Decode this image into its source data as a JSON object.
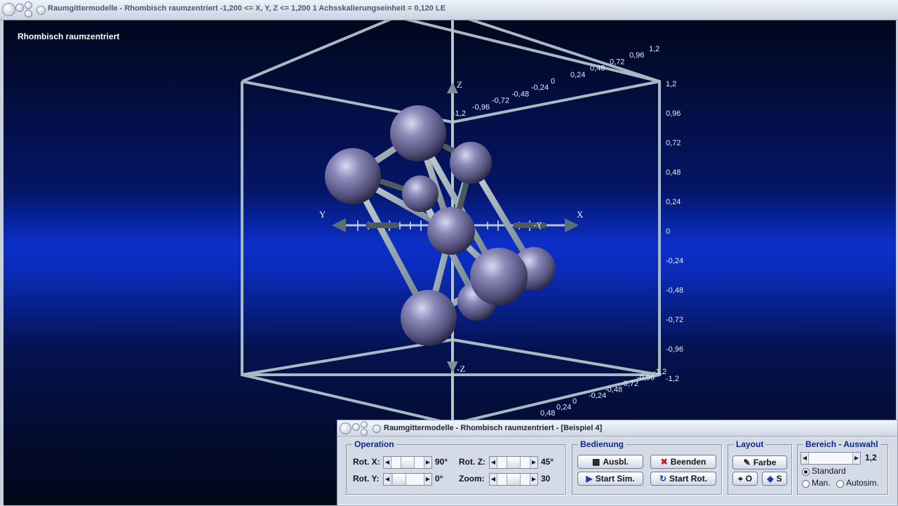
{
  "window": {
    "title": "Raumgittermodelle - Rhombisch raumzentriert   -1,200 <= X, Y, Z <= 1,200    1 Achsskalierungseinheit = 0,120 LE"
  },
  "scene": {
    "label": "Rhombisch raumzentriert",
    "axes": {
      "x": "X",
      "y": "Y",
      "z": "Z",
      "minus_z": "-Z",
      "minus_y": "-Y"
    },
    "ticks_right": [
      "1,2",
      "0,96",
      "0,72",
      "0,48",
      "0,24",
      "0",
      "-0,24",
      "-0,48",
      "-0,72",
      "-0,96",
      "-1,2"
    ],
    "ticks_top": [
      "-1,2",
      "-0,96",
      "-0,72",
      "-0,48",
      "-0,24",
      "0",
      "0,24",
      "0,48",
      "0,72",
      "0,96",
      "1,2"
    ],
    "ticks_bottom": [
      "0,48",
      "0,24",
      "0",
      "-0,24",
      "-0,48",
      "-0,72",
      "-0,96",
      "-1,2"
    ],
    "colors": {
      "atom": "#7b78a8",
      "bond": "#9aa9b0",
      "frame": "#a8bcc4"
    }
  },
  "panel": {
    "title": "Raumgittermodelle - Rhombisch raumzentriert - [Beispiel 4]",
    "operation": {
      "legend": "Operation",
      "rot_x_label": "Rot. X:",
      "rot_x_value": "90°",
      "rot_y_label": "Rot. Y:",
      "rot_y_value": "0°",
      "rot_z_label": "Rot. Z:",
      "rot_z_value": "45°",
      "zoom_label": "Zoom:",
      "zoom_value": "30"
    },
    "bedienung": {
      "legend": "Bedienung",
      "ausbl": "Ausbl.",
      "beenden": "Beenden",
      "start_sim": "Start Sim.",
      "start_rot": "Start Rot."
    },
    "layout": {
      "legend": "Layout",
      "farbe": "Farbe",
      "o_label": "O",
      "s_label": "S"
    },
    "bereich": {
      "legend": "Bereich - Auswahl",
      "value": "1,2",
      "standard": "Standard",
      "man": "Man.",
      "autosim": "Autosim.",
      "selected": "Standard"
    }
  }
}
